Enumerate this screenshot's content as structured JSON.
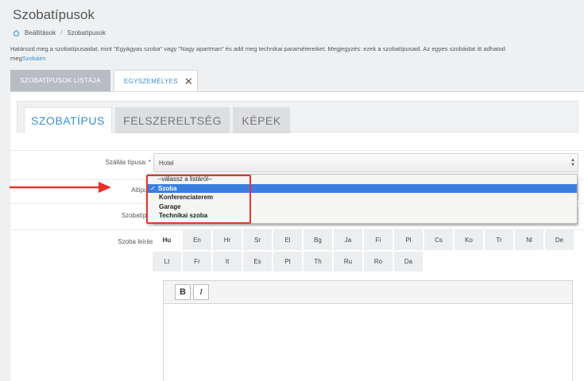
{
  "page": {
    "title": "Szobatípusok",
    "breadcrumb": [
      "Beállítások",
      "Szobatípusok"
    ],
    "intro_text": "Határozd meg a szobatípusaidat, mint \"Egyágyas szoba\" vagy \"Nagy apartman\" és add meg technikai paramétereiket. Megjegyzés: ezek a szobatípusaid. Az egyes szobáidat itt adhatod",
    "intro_prefix": "meg",
    "intro_link": "Szobáim"
  },
  "top_tabs": [
    {
      "label": "SZOBATÍPUSOK LISTÁJA",
      "active": false
    },
    {
      "label": "EGYSZEMÉLYES",
      "active": true
    }
  ],
  "sub_tabs": [
    {
      "label": "SZOBATÍPUS",
      "active": true
    },
    {
      "label": "FELSZERELTSÉG",
      "active": false
    },
    {
      "label": "KÉPEK",
      "active": false
    }
  ],
  "form": {
    "accommodation_type_label": "Szállás típusa: *",
    "accommodation_type_value": "Hotel",
    "subtype_label": "Altípus *",
    "room_type_label": "Szobatípus:",
    "room_desc_label": "Szoba leírás:"
  },
  "dropdown": {
    "options": [
      "--válassz a listáról--",
      "Szoba",
      "Konferenciaterem",
      "Garage",
      "Technikai szoba"
    ],
    "selected": "Szoba"
  },
  "languages": {
    "row1": [
      "Hu",
      "En",
      "Hr",
      "Sr",
      "El",
      "Bg",
      "Ja",
      "Fi",
      "Pl",
      "Cs",
      "Ko",
      "Tr",
      "Nl",
      "De"
    ],
    "row2": [
      "Lt",
      "Fr",
      "It",
      "Es",
      "Pt",
      "Th",
      "Ru",
      "Ro",
      "Da"
    ],
    "active": "Hu"
  },
  "editor": {
    "bold_label": "B",
    "italic_label": "I"
  },
  "colors": {
    "accent": "#3a8fcf",
    "highlight": "#e8322b",
    "selected_option": "#3a7fe0"
  }
}
